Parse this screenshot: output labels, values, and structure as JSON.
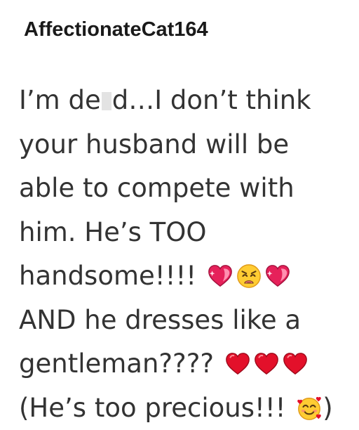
{
  "comment": {
    "username": "AffectionateCat164",
    "lines": [
      {
        "parts": [
          {
            "kind": "text",
            "value": "I’m de"
          },
          {
            "kind": "redaction"
          },
          {
            "kind": "text",
            "value": "d…I don’t think"
          }
        ]
      },
      {
        "parts": [
          {
            "kind": "text",
            "value": "your husband will be"
          }
        ]
      },
      {
        "parts": [
          {
            "kind": "text",
            "value": "able to compete with"
          }
        ]
      },
      {
        "parts": [
          {
            "kind": "text",
            "value": "him. He’s TOO"
          }
        ]
      },
      {
        "parts": [
          {
            "kind": "text",
            "value": "handsome!!!! "
          },
          {
            "kind": "emoji",
            "icon": "sparkling-pink-heart-icon"
          },
          {
            "kind": "emoji",
            "icon": "weary-face-icon"
          },
          {
            "kind": "emoji",
            "icon": "sparkling-pink-heart-icon"
          }
        ]
      },
      {
        "parts": [
          {
            "kind": "text",
            "value": "AND he dresses like a"
          }
        ]
      },
      {
        "parts": [
          {
            "kind": "text",
            "value": "gentleman???? "
          },
          {
            "kind": "emoji",
            "icon": "red-heart-icon"
          },
          {
            "kind": "emoji",
            "icon": "red-heart-icon"
          },
          {
            "kind": "emoji",
            "icon": "red-heart-icon"
          }
        ]
      },
      {
        "parts": [
          {
            "kind": "text",
            "value": "(He’s too precious!!! "
          },
          {
            "kind": "emoji",
            "icon": "smiling-face-with-hearts-icon"
          },
          {
            "kind": "text",
            "value": ")"
          }
        ]
      }
    ]
  },
  "colors": {
    "username": "#1a1a1a",
    "body_text": "#333333",
    "background": "#ffffff",
    "redaction": "#e3e3e3"
  }
}
